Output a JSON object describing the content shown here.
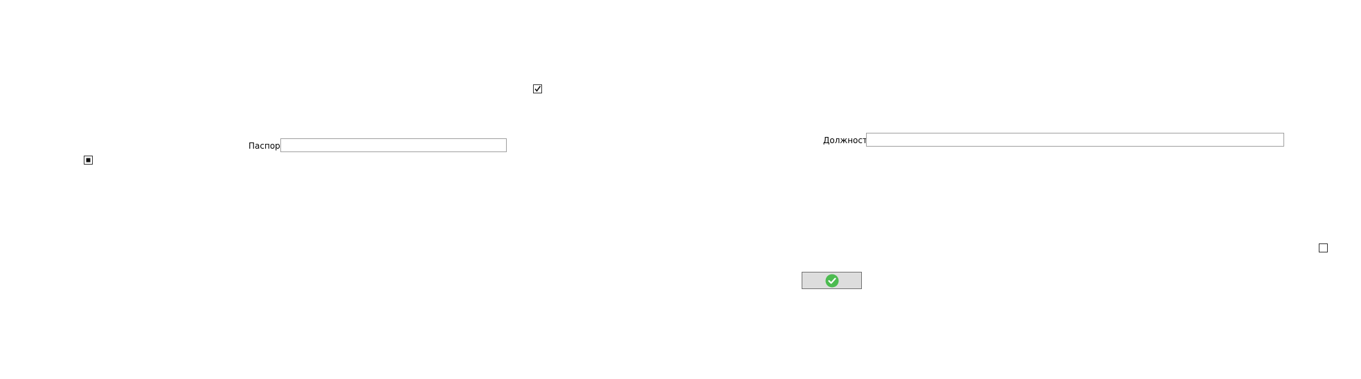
{
  "form": {
    "passport": {
      "label": "Паспорт",
      "value": "",
      "placeholder": ""
    },
    "position": {
      "label": "Должность",
      "value": "",
      "placeholder": ""
    },
    "checkboxes": {
      "top": {
        "state": "checked"
      },
      "left": {
        "state": "indeterminate"
      },
      "right": {
        "state": "unchecked"
      }
    },
    "submit": {
      "icon": "check-circle-icon",
      "icon_color": "#4cbb50"
    }
  }
}
